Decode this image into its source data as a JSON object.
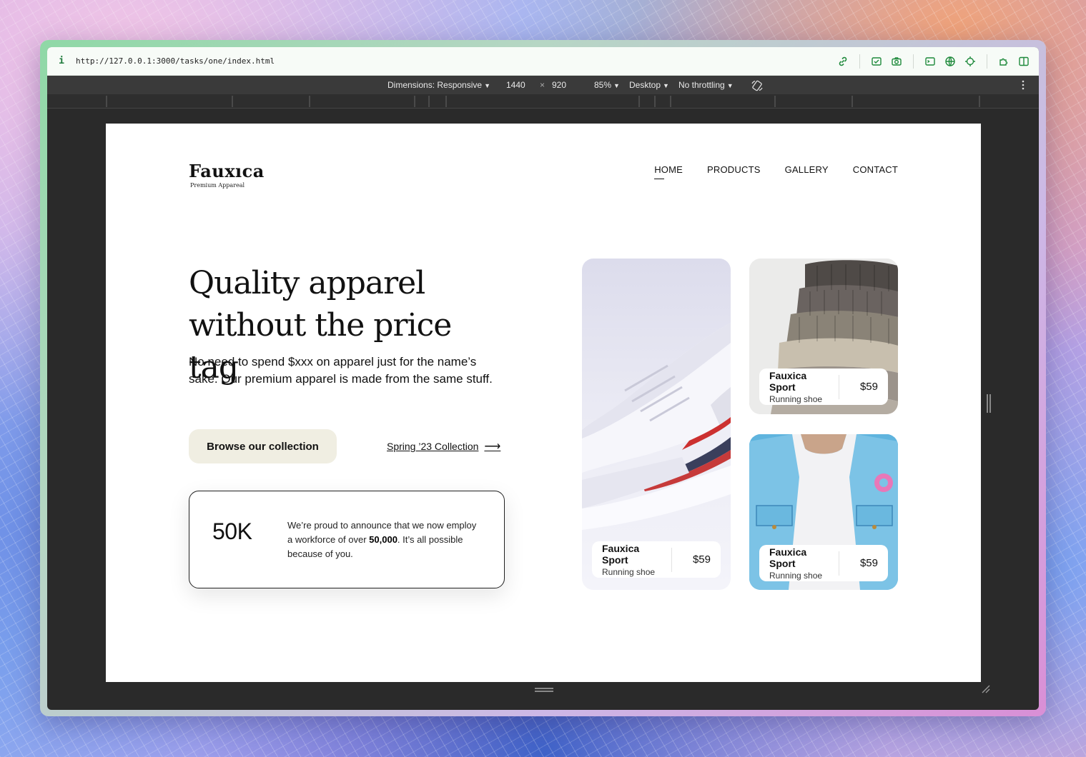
{
  "browser": {
    "url": "http://127.0.0.1:3000/tasks/one/index.html",
    "devtools": {
      "dimensions_label": "Dimensions: Responsive",
      "width": "1440",
      "times": "×",
      "height": "920",
      "zoom": "85%",
      "device": "Desktop",
      "throttling": "No throttling"
    }
  },
  "site": {
    "logo": {
      "name": "Fauxıca",
      "tagline": "Premium Appareal"
    },
    "nav": [
      {
        "label": "HOME",
        "active": true
      },
      {
        "label": "PRODUCTS",
        "active": false
      },
      {
        "label": "GALLERY",
        "active": false
      },
      {
        "label": "CONTACT",
        "active": false
      }
    ],
    "hero": {
      "headline": "Quality apparel without the price tag",
      "subtext": "No need to spend $xxx on apparel just for the name’s sake. Our premium apparel is made from the same stuff.",
      "cta_label": "Browse our collection",
      "collection_link": "Spring ’23 Collection",
      "arrow": "⟶"
    },
    "stat": {
      "number": "50K",
      "text_before": "We’re proud to announce that we now employ a workforce of over ",
      "text_bold": "50,000",
      "text_after": ". It’s all possible because of you."
    },
    "products": [
      {
        "name": "Fauxica Sport",
        "subtitle": "Running shoe",
        "price": "$59"
      },
      {
        "name": "Fauxica Sport",
        "subtitle": "Running shoe",
        "price": "$59"
      },
      {
        "name": "Fauxica Sport",
        "subtitle": "Running shoe",
        "price": "$59"
      }
    ]
  }
}
